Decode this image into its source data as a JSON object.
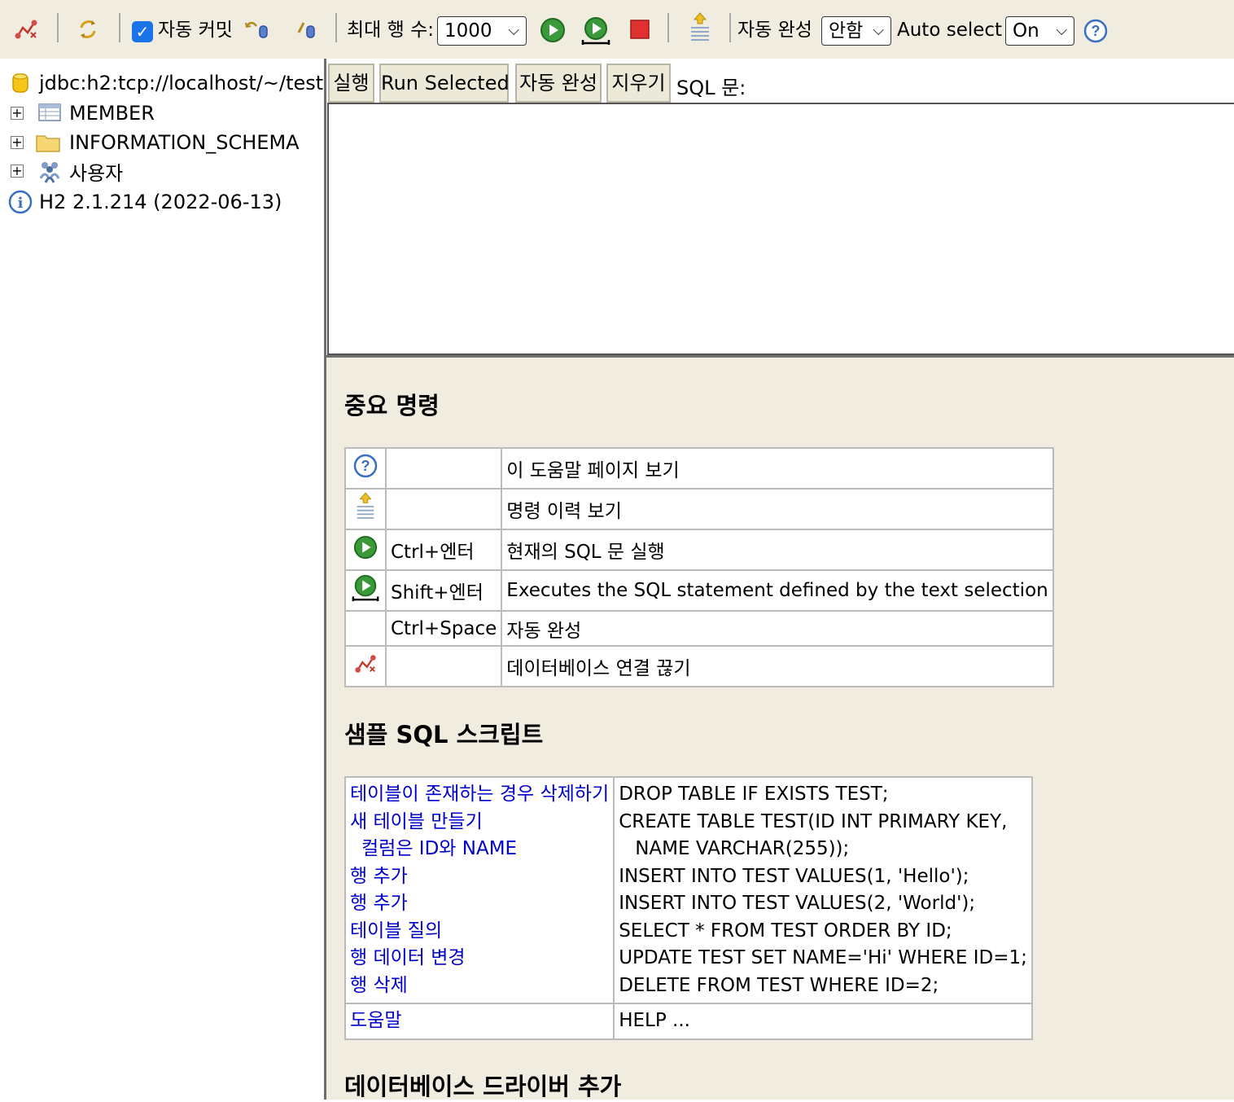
{
  "toolbar": {
    "autocommit_label": "자동 커밋",
    "max_rows_label": "최대 행 수:",
    "max_rows_value": "1000",
    "autocomplete_label": "자동 완성",
    "autocomplete_value": "안함",
    "auto_select_label": "Auto select",
    "auto_select_value": "On"
  },
  "tree": {
    "connection": "jdbc:h2:tcp://localhost/~/test",
    "items": [
      {
        "label": "MEMBER",
        "icon": "table-icon"
      },
      {
        "label": "INFORMATION_SCHEMA",
        "icon": "folder-icon"
      },
      {
        "label": "사용자",
        "icon": "users-icon"
      }
    ],
    "version": "H2 2.1.214 (2022-06-13)"
  },
  "query": {
    "run_label": "실행",
    "run_selected_label": "Run Selected",
    "autocomplete_label": "자동 완성",
    "clear_label": "지우기",
    "sql_label": "SQL 문:",
    "sql_text": ""
  },
  "help": {
    "important_title": "중요 명령",
    "commands": [
      {
        "icon": "help-icon",
        "shortcut": "",
        "desc": "이 도움말 페이지 보기"
      },
      {
        "icon": "history-icon",
        "shortcut": "",
        "desc": "명령 이력 보기"
      },
      {
        "icon": "run-icon",
        "shortcut": "Ctrl+엔터",
        "desc": "현재의 SQL 문 실행"
      },
      {
        "icon": "run-selected-icon",
        "shortcut": "Shift+엔터",
        "desc": "Executes the SQL statement defined by the text selection"
      },
      {
        "icon": "",
        "shortcut": "Ctrl+Space",
        "desc": "자동 완성"
      },
      {
        "icon": "disconnect-icon",
        "shortcut": "",
        "desc": "데이터베이스 연결 끊기"
      }
    ],
    "sample_title": "샘플 SQL 스크립트",
    "samples": [
      {
        "link": "테이블이 존재하는 경우 삭제하기",
        "sql": "DROP TABLE IF EXISTS TEST;"
      },
      {
        "link": "새 테이블 만들기",
        "sql": "CREATE TABLE TEST(ID INT PRIMARY KEY,"
      },
      {
        "link": "컬럼은 ID와 NAME",
        "sql": "NAME VARCHAR(255));"
      },
      {
        "link": "행 추가",
        "sql": "INSERT INTO TEST VALUES(1, 'Hello');"
      },
      {
        "link": "행 추가",
        "sql": "INSERT INTO TEST VALUES(2, 'World');"
      },
      {
        "link": "테이블 질의",
        "sql": "SELECT * FROM TEST ORDER BY ID;"
      },
      {
        "link": "행 데이터 변경",
        "sql": "UPDATE TEST SET NAME='Hi' WHERE ID=1;"
      },
      {
        "link": "행 삭제",
        "sql": "DELETE FROM TEST WHERE ID=2;"
      }
    ],
    "help_link": "도움말",
    "help_sql": "HELP ...",
    "driver_title": "데이터베이스 드라이버 추가"
  }
}
